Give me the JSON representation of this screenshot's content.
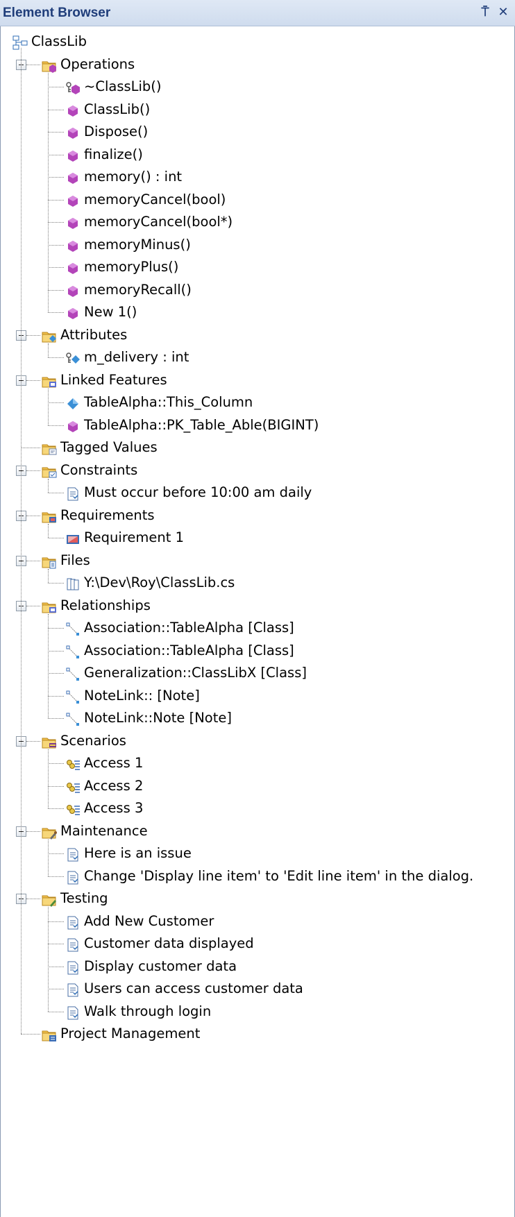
{
  "window": {
    "title": "Element Browser",
    "pin_glyph": "⍑",
    "close_glyph": "✕"
  },
  "colors": {
    "title_bg": "#cfdcee",
    "title_text": "#1f3d7a",
    "folder": "#f2c24d",
    "operation": "#b344b9",
    "attribute": "#3a8fd6"
  },
  "root": {
    "label": "ClassLib",
    "icon": "class-hierarchy-icon"
  },
  "groups": [
    {
      "label": "Operations",
      "icon": "operations-folder-icon",
      "children": [
        {
          "label": "~ClassLib()",
          "icon": "protected-operation-icon"
        },
        {
          "label": "ClassLib()",
          "icon": "operation-icon"
        },
        {
          "label": "Dispose()",
          "icon": "operation-icon"
        },
        {
          "label": "finalize()",
          "icon": "operation-icon"
        },
        {
          "label": "memory() : int",
          "icon": "operation-icon"
        },
        {
          "label": "memoryCancel(bool)",
          "icon": "operation-icon"
        },
        {
          "label": "memoryCancel(bool*)",
          "icon": "operation-icon"
        },
        {
          "label": "memoryMinus()",
          "icon": "operation-icon"
        },
        {
          "label": "memoryPlus()",
          "icon": "operation-icon"
        },
        {
          "label": "memoryRecall()",
          "icon": "operation-icon"
        },
        {
          "label": "New 1()",
          "icon": "operation-icon"
        }
      ]
    },
    {
      "label": "Attributes",
      "icon": "attributes-folder-icon",
      "children": [
        {
          "label": "m_delivery : int",
          "icon": "protected-attribute-icon"
        }
      ]
    },
    {
      "label": "Linked Features",
      "icon": "linked-features-folder-icon",
      "children": [
        {
          "label": "TableAlpha::This_Column",
          "icon": "attribute-icon"
        },
        {
          "label": "TableAlpha::PK_Table_Able(BIGINT)",
          "icon": "operation-icon"
        }
      ]
    },
    {
      "label": "Tagged Values",
      "icon": "tagged-values-folder-icon",
      "children": []
    },
    {
      "label": "Constraints",
      "icon": "constraints-folder-icon",
      "children": [
        {
          "label": "Must occur before 10:00 am daily",
          "icon": "document-icon"
        }
      ]
    },
    {
      "label": "Requirements",
      "icon": "requirements-folder-icon",
      "children": [
        {
          "label": "Requirement 1",
          "icon": "requirement-icon"
        }
      ]
    },
    {
      "label": "Files",
      "icon": "files-folder-icon",
      "children": [
        {
          "label": "Y:\\Dev\\Roy\\ClassLib.cs",
          "icon": "file-icon"
        }
      ]
    },
    {
      "label": "Relationships",
      "icon": "relationships-folder-icon",
      "children": [
        {
          "label": "Association::TableAlpha [Class]",
          "icon": "relationship-icon"
        },
        {
          "label": "Association::TableAlpha [Class]",
          "icon": "relationship-icon"
        },
        {
          "label": "Generalization::ClassLibX [Class]",
          "icon": "relationship-icon"
        },
        {
          "label": "NoteLink:: [Note]",
          "icon": "relationship-icon"
        },
        {
          "label": "NoteLink::Note [Note]",
          "icon": "relationship-icon"
        }
      ]
    },
    {
      "label": "Scenarios",
      "icon": "scenarios-folder-icon",
      "children": [
        {
          "label": "Access 1",
          "icon": "scenario-icon"
        },
        {
          "label": "Access 2",
          "icon": "scenario-icon"
        },
        {
          "label": "Access 3",
          "icon": "scenario-icon"
        }
      ]
    },
    {
      "label": "Maintenance",
      "icon": "maintenance-folder-icon",
      "children": [
        {
          "label": "Here is an issue",
          "icon": "document-icon"
        },
        {
          "label": "Change 'Display line item' to 'Edit line item' in the dialog.",
          "icon": "document-icon"
        }
      ]
    },
    {
      "label": "Testing",
      "icon": "testing-folder-icon",
      "children": [
        {
          "label": "Add New Customer",
          "icon": "document-icon"
        },
        {
          "label": "Customer data displayed",
          "icon": "document-icon"
        },
        {
          "label": "Display customer data",
          "icon": "document-icon"
        },
        {
          "label": "Users can access customer data",
          "icon": "document-icon"
        },
        {
          "label": "Walk through login",
          "icon": "document-icon"
        }
      ]
    },
    {
      "label": "Project Management",
      "icon": "project-management-folder-icon",
      "children": []
    }
  ]
}
